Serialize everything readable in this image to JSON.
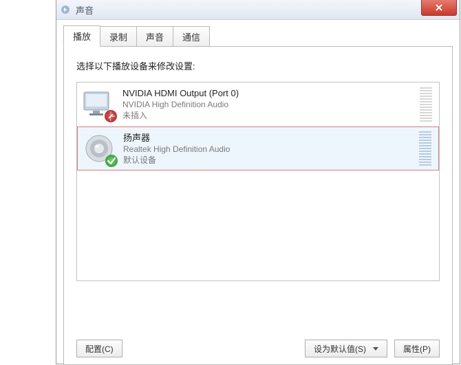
{
  "window": {
    "title": "声音"
  },
  "tabs": [
    {
      "label": "播放",
      "active": true
    },
    {
      "label": "录制",
      "active": false
    },
    {
      "label": "声音",
      "active": false
    },
    {
      "label": "通信",
      "active": false
    }
  ],
  "instruction": "选择以下播放设备来修改设置:",
  "devices": [
    {
      "name": "NVIDIA HDMI Output (Port 0)",
      "driver": "NVIDIA High Definition Audio",
      "status": "未插入",
      "state": "unplugged",
      "selected": false
    },
    {
      "name": "扬声器",
      "driver": "Realtek High Definition Audio",
      "status": "默认设备",
      "state": "default",
      "selected": true
    }
  ],
  "buttons": {
    "configure": "配置(C)",
    "set_default": "设为默认值(S)",
    "properties": "属性(P)"
  }
}
